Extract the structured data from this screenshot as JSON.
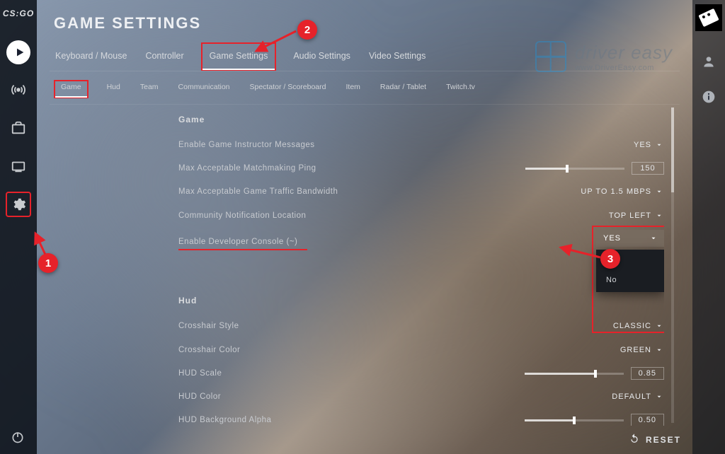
{
  "logo": "CS:GO",
  "page_title": "GAME SETTINGS",
  "primary_tabs": [
    "Keyboard / Mouse",
    "Controller",
    "Game Settings",
    "Audio Settings",
    "Video Settings"
  ],
  "primary_active": 2,
  "sub_tabs": [
    "Game",
    "Hud",
    "Team",
    "Communication",
    "Spectator / Scoreboard",
    "Item",
    "Radar / Tablet",
    "Twitch.tv"
  ],
  "sub_active": 0,
  "sections": {
    "game": {
      "heading": "Game",
      "rows": {
        "instructor": {
          "label": "Enable Game Instructor Messages",
          "value": "YES"
        },
        "ping": {
          "label": "Max Acceptable Matchmaking Ping",
          "value": "150",
          "fill": "42%"
        },
        "bandwidth": {
          "label": "Max Acceptable Game Traffic Bandwidth",
          "value": "UP TO 1.5 MBPS"
        },
        "community": {
          "label": "Community Notification Location",
          "value": "TOP LEFT"
        },
        "console": {
          "label": "Enable Developer Console (~)",
          "value": "YES",
          "options": [
            "Yes",
            "No"
          ]
        }
      }
    },
    "hud": {
      "heading": "Hud",
      "rows": {
        "cross_style": {
          "label": "Crosshair Style",
          "value": "CLASSIC"
        },
        "cross_color": {
          "label": "Crosshair Color",
          "value": "GREEN"
        },
        "hud_scale": {
          "label": "HUD Scale",
          "value": "0.85",
          "fill": "72%"
        },
        "hud_color": {
          "label": "HUD Color",
          "value": "DEFAULT"
        },
        "hud_alpha": {
          "label": "HUD Background Alpha",
          "value": "0.50",
          "fill": "50%"
        }
      }
    }
  },
  "reset_label": "RESET",
  "watermark": {
    "t1": "driver easy",
    "t2": "www.DriverEasy.com"
  },
  "callouts": {
    "c1": "1",
    "c2": "2",
    "c3": "3"
  }
}
